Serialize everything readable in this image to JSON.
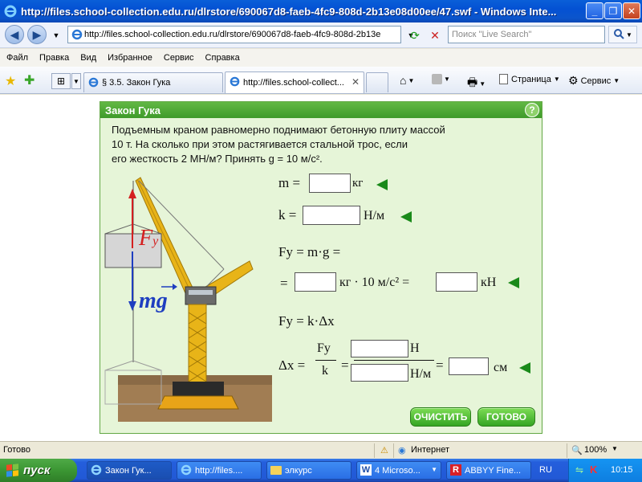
{
  "window": {
    "title": "http://files.school-collection.edu.ru/dlrstore/690067d8-faeb-4fc9-808d-2b13e08d00ee/47.swf - Windows Inte...",
    "min_label": "_",
    "max_label": "❐",
    "close_label": "✕"
  },
  "address_bar": {
    "url": "http://files.school-collection.edu.ru/dlrstore/690067d8-faeb-4fc9-808d-2b13e",
    "search_placeholder": "Поиск \"Live Search\""
  },
  "menu": {
    "items": [
      "Файл",
      "Правка",
      "Вид",
      "Избранное",
      "Сервис",
      "Справка"
    ]
  },
  "tabs": [
    {
      "label": "§ 3.5. Закон Гука"
    },
    {
      "label": "http://files.school-collect..."
    }
  ],
  "toolbar": {
    "page_label": "Страница",
    "tools_label": "Сервис"
  },
  "panel": {
    "title": "Закон Гука",
    "help_label": "?",
    "problem_lines": [
      "Подъемным краном равномерно поднимают бетонную плиту массой",
      "10 т. На сколько при этом растягивается стальной трос, если",
      "его жесткость 2 МН/м? Принять g = 10 м/с²."
    ],
    "force_elastic_label": "F",
    "force_elastic_sub": "y",
    "gravity_label": "mg",
    "equations": {
      "m_label": "m =",
      "m_unit": "кг",
      "k_label": "k =",
      "k_unit": "Н/м",
      "fy_mg_label": "Fy = m·g =",
      "eq_sign": "=",
      "kg_times_g": "кг · 10 м/с² =",
      "kn_unit": "кН",
      "fy_kdx_label": "Fy = k·Δx",
      "dx_label": "Δx =",
      "frac_num": "Fy",
      "frac_den": "k",
      "n_unit": "Н",
      "nm_unit": "Н/м",
      "cm_unit": "см"
    },
    "clear_button": "ОЧИСТИТЬ",
    "done_button": "ГОТОВО"
  },
  "statusbar": {
    "status": "Готово",
    "zone": "Интернет",
    "zoom": "100%"
  },
  "taskbar": {
    "start_label": "пуск",
    "tasks": [
      "Закон Гук...",
      "http://files....",
      "элкурс",
      "4 Microso...",
      "ABBYY Fine..."
    ],
    "lang": "RU",
    "clock": "10:15"
  },
  "colors": {
    "panel_bg": "#e6f5d8",
    "panel_header": "#4aa834",
    "arrow_green": "#1a8a1a",
    "force_red": "#d42020",
    "gravity_blue": "#1e3ec0"
  }
}
